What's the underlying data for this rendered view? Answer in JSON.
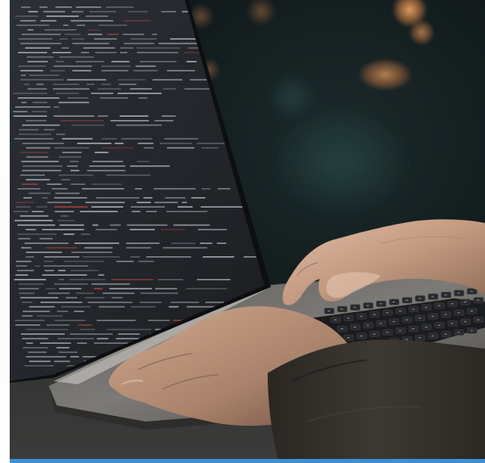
{
  "image": {
    "subject": "hands-typing-on-laptop-keyboard-with-code-screen",
    "scene": "dark-bokeh-background",
    "colors": {
      "background_dark": "#0c1416",
      "bokeh_warm": "#d78a52",
      "screen_bg": "#1d2128",
      "screen_text": "#c9ccd3",
      "code_red": "#c2453b",
      "laptop_silver": "#8d8b87",
      "sleeve": "#332f2a",
      "skin": "#c6a088",
      "accent_strip": "#3b8fd6"
    }
  }
}
